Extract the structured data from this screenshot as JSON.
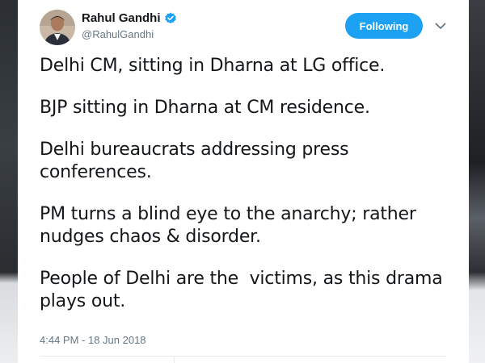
{
  "tweet": {
    "author_name": "Rahul Gandhi",
    "author_handle": "@RahulGandhi",
    "verified": true,
    "follow_label": "Following",
    "paragraphs": [
      "Delhi CM, sitting in Dharna at LG office.",
      "BJP sitting in Dharna at CM residence.",
      "Delhi bureaucrats addressing press\nconferences.",
      "PM turns a blind eye to the anarchy; rather\nnudges chaos & disorder.",
      "People of Delhi are the  victims, as this drama\nplays out."
    ],
    "timestamp": "4:44 PM - 18 Jun 2018"
  },
  "icons": {
    "verified": "verified-badge-icon",
    "caret": "chevron-down-icon"
  },
  "colors": {
    "accent": "#1da1f2",
    "text_primary": "#14171a",
    "text_secondary": "#657786"
  }
}
